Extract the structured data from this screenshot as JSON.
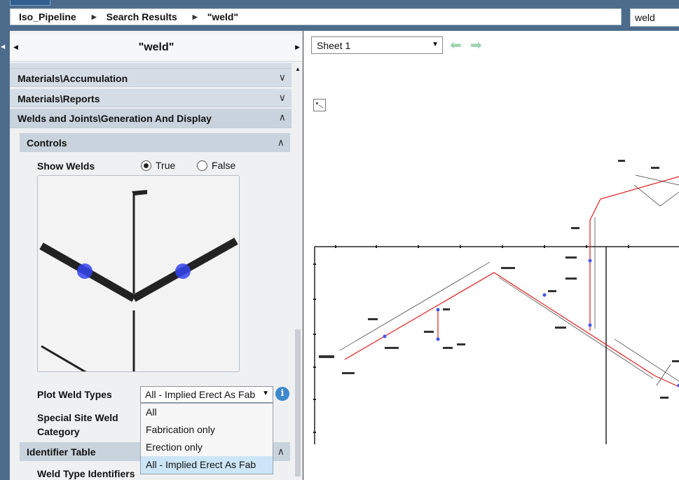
{
  "breadcrumb": {
    "items": [
      "Iso_Pipeline",
      "Search Results",
      "\"weld\""
    ]
  },
  "search": {
    "value": "weld"
  },
  "left_panel": {
    "title": "\"weld\"",
    "sections": [
      {
        "label": "Materials\\Accumulation",
        "expanded": false
      },
      {
        "label": "Materials\\Reports",
        "expanded": false
      },
      {
        "label": "Welds and Joints\\Generation And Display",
        "expanded": true
      }
    ],
    "controls": {
      "title": "Controls",
      "show_welds": {
        "label": "Show Welds",
        "options": [
          "True",
          "False"
        ],
        "selected": "True"
      },
      "plot_weld_types": {
        "label": "Plot Weld Types",
        "value": "All - Implied Erect As Fab",
        "options": [
          "All",
          "Fabrication only",
          "Erection only",
          "All - Implied Erect As Fab"
        ]
      },
      "special_site_weld": {
        "label_line1": "Special Site Weld",
        "label_line2": "Category"
      }
    },
    "identifier_table": {
      "title": "Identifier Table",
      "weld_type_label": "Weld Type Identifiers"
    }
  },
  "viewer": {
    "sheet": "Sheet 1"
  },
  "icons": [
    "chevron-down-icon",
    "chevron-up-icon",
    "info-icon",
    "back-arrow-icon",
    "forward-arrow-icon",
    "image-placeholder-icon"
  ],
  "colors": {
    "header_band": "#4d6c8c",
    "section_bg": "#d4dde6",
    "selected_option": "#cce6f7",
    "weld_marker": "#3344ee",
    "pipe_line": "#e02020",
    "nav_arrow": "#9fd3b0"
  }
}
